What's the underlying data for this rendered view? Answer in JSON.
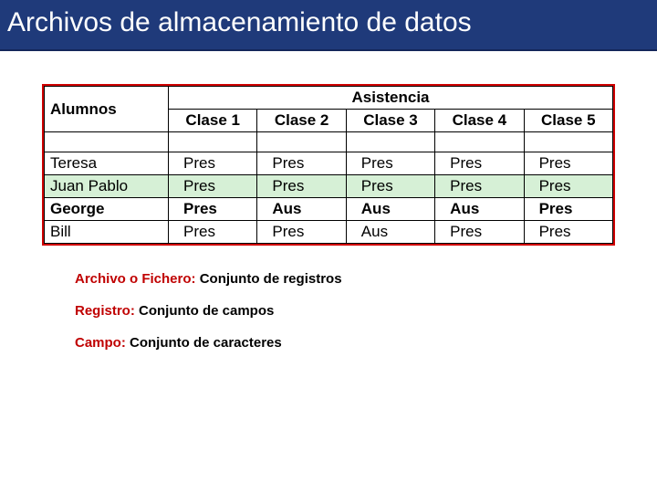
{
  "title": "Archivos de almacenamiento de datos",
  "table": {
    "header": {
      "alumnos": "Alumnos",
      "asistencia": "Asistencia",
      "clases": [
        "Clase 1",
        "Clase 2",
        "Clase 3",
        "Clase 4",
        "Clase 5"
      ]
    },
    "rows": [
      {
        "name": "Teresa",
        "cells": [
          "Pres",
          "Pres",
          "Pres",
          "Pres",
          "Pres"
        ],
        "highlight": false,
        "bold": false
      },
      {
        "name": "Juan Pablo",
        "cells": [
          "Pres",
          "Pres",
          "Pres",
          "Pres",
          "Pres"
        ],
        "highlight": true,
        "bold": false
      },
      {
        "name": "George",
        "cells": [
          "Pres",
          "Aus",
          "Aus",
          "Aus",
          "Pres"
        ],
        "highlight": false,
        "bold": true
      },
      {
        "name": "Bill",
        "cells": [
          "Pres",
          "Pres",
          "Aus",
          "Pres",
          "Pres"
        ],
        "highlight": false,
        "bold": false
      }
    ]
  },
  "definitions": [
    {
      "term": "Archivo o Fichero:",
      "desc": " Conjunto de registros"
    },
    {
      "term": "Registro:",
      "desc": " Conjunto de campos"
    },
    {
      "term": "Campo:",
      "desc": " Conjunto de caracteres"
    }
  ]
}
